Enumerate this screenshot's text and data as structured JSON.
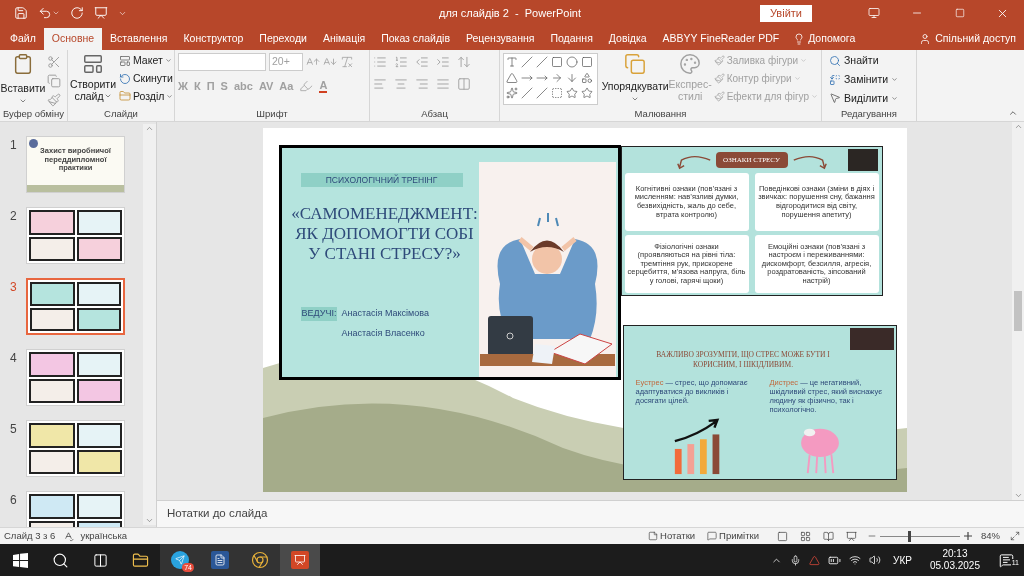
{
  "window": {
    "title": "для слайдів 2  -  PowerPoint",
    "sign_in": "Увійти"
  },
  "tabs": [
    {
      "label": "Файл",
      "selected": false
    },
    {
      "label": "Основне",
      "selected": true
    },
    {
      "label": "Вставлення",
      "selected": false
    },
    {
      "label": "Конструктор",
      "selected": false
    },
    {
      "label": "Переходи",
      "selected": false
    },
    {
      "label": "Анімація",
      "selected": false
    },
    {
      "label": "Показ слайдів",
      "selected": false
    },
    {
      "label": "Рецензування",
      "selected": false
    },
    {
      "label": "Подання",
      "selected": false
    },
    {
      "label": "Довідка",
      "selected": false
    },
    {
      "label": "ABBYY FineReader PDF",
      "selected": false
    }
  ],
  "tell_me": "Допомога",
  "share": "Спільний доступ",
  "ribbon": {
    "clipboard": {
      "label": "Буфер обміну",
      "paste": "Вставити"
    },
    "slides": {
      "label": "Слайди",
      "new_slide": [
        "Створити",
        "слайд"
      ],
      "layout": "Макет",
      "reset": "Скинути",
      "section": "Розділ"
    },
    "font": {
      "label": "Шрифт",
      "size": "20+",
      "disabled": true,
      "format_buttons": [
        "Ж",
        "К",
        "П",
        "S",
        "abc",
        "AV",
        "Aa"
      ],
      "font_color": "A"
    },
    "paragraph": {
      "label": "Абзац",
      "disabled": true
    },
    "drawing": {
      "label": "Малювання",
      "arrange": "Упорядкувати",
      "quick_styles": [
        "Експрес-",
        "стилі"
      ],
      "disabled": true,
      "format_items": [
        "Заливка фігури",
        "Контур фігури",
        "Ефекти для фігур"
      ]
    },
    "editing": {
      "label": "Редагування",
      "find": "Знайти",
      "replace": "Замінити",
      "select": "Виділити"
    }
  },
  "thumbnails": [
    {
      "number": "1",
      "kind": "title",
      "selected": false,
      "title": "Захист виробничої переддипломної практики"
    },
    {
      "number": "2",
      "kind": "collage",
      "selected": false
    },
    {
      "number": "3",
      "kind": "collage",
      "selected": true
    },
    {
      "number": "4",
      "kind": "collage",
      "selected": false
    },
    {
      "number": "5",
      "kind": "collage",
      "selected": false
    },
    {
      "number": "6",
      "kind": "collage",
      "selected": false
    }
  ],
  "slide": {
    "title_image": {
      "kicker": "ПСИХОЛОГІЧНИЙ ТРЕНІНГ",
      "title_lines": [
        "«САМОМЕНЕДЖМЕНТ:",
        "ЯК ДОПОМОГТИ СОБІ",
        "У СТАНІ СТРЕСУ?»"
      ],
      "hosts_label": "ВЕДУЧІ:",
      "hosts": [
        "Анастасія Максімова",
        "Анастасія Власенко"
      ]
    },
    "signs_image": {
      "heading": "ОЗНАКИ СТРЕСУ",
      "cards": [
        "Когнітивні ознаки (пов’язані з мисленням: нав’язливі думки, безвихідність, жаль до себе, втрата контролю)",
        "Поведінкові ознаки (зміни в діях і звичках: порушення сну, бажання відгородитися від світу, порушення апетиту)",
        "Фізіологічні ознаки (проявляються на рівні тіла: тремтіння рук, прискорене серцебиття, м’язова напруга, біль у голові, гарячі щоки)",
        "Емоційні ознаки (пов’язані з настроєм і переживаннями: дискомфорт, безсилля, агресія, роздратованість, зіпсований настрій)"
      ]
    },
    "stress_image": {
      "heading": "ВАЖЛИВО ЗРОЗУМІТИ, ЩО СТРЕС МОЖЕ БУТИ І КОРИСНИМ, І ШКІДЛИВИМ.",
      "columns": [
        {
          "term": "Еустрес",
          "definition": " — стрес, що допомагає адаптуватися до викликів і досягати цілей."
        },
        {
          "term": "Дистрес",
          "definition": " — це негативний, шкідливий стрес, який виснажує людину як фізично, так і психологічно."
        }
      ]
    }
  },
  "notes_placeholder": "Нотатки до слайда",
  "status_bar": {
    "slide_count": "Слайд 3 з 6",
    "language": "українська",
    "notes": "Нотатки",
    "comments": "Примітки",
    "zoom_slider": {
      "level": 0.36
    },
    "zoom": "84%"
  },
  "taskbar": {
    "telegram_badge": "74",
    "input_language": "УКР",
    "time": "20:13",
    "date": "05.03.2025",
    "notifications": "11"
  }
}
